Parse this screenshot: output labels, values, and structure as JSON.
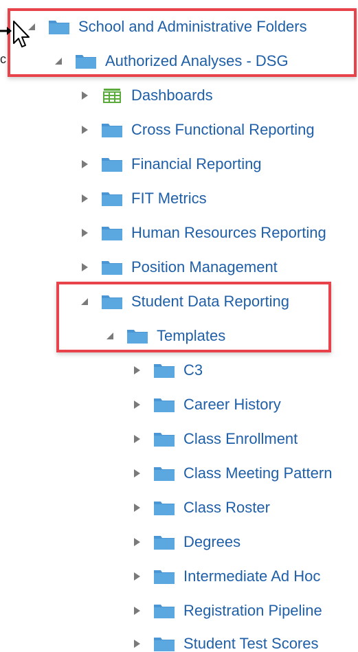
{
  "tree": {
    "root": {
      "label": "School and Administrative Folders",
      "state": "expanded"
    },
    "level1": {
      "label": "Authorized Analyses - DSG",
      "state": "expanded"
    },
    "level2": [
      {
        "label": "Dashboards",
        "icon": "dashboard-icon",
        "state": "collapsed"
      },
      {
        "label": "Cross Functional Reporting",
        "icon": "folder-icon",
        "state": "collapsed"
      },
      {
        "label": "Financial Reporting",
        "icon": "folder-icon",
        "state": "collapsed"
      },
      {
        "label": "FIT Metrics",
        "icon": "folder-icon",
        "state": "collapsed"
      },
      {
        "label": "Human Resources Reporting",
        "icon": "folder-icon",
        "state": "collapsed"
      },
      {
        "label": "Position Management",
        "icon": "folder-icon",
        "state": "collapsed"
      },
      {
        "label": "Student Data Reporting",
        "icon": "folder-icon",
        "state": "expanded"
      }
    ],
    "level3": {
      "label": "Templates",
      "state": "expanded"
    },
    "level4": [
      {
        "label": "C3"
      },
      {
        "label": "Career History"
      },
      {
        "label": "Class Enrollment"
      },
      {
        "label": "Class Meeting Pattern"
      },
      {
        "label": "Class Roster"
      },
      {
        "label": "Degrees"
      },
      {
        "label": "Intermediate Ad Hoc"
      },
      {
        "label": "Registration Pipeline"
      },
      {
        "label": "Student Test Scores"
      }
    ]
  },
  "edge_text": "c",
  "colors": {
    "label": "#1f5fa8",
    "folder": "#5ba7e0",
    "folder_tab": "#4a95d3",
    "highlight": "#e8424a",
    "triangle": "#7a7a7a",
    "dashboard_icon": "#5aaa3c"
  }
}
